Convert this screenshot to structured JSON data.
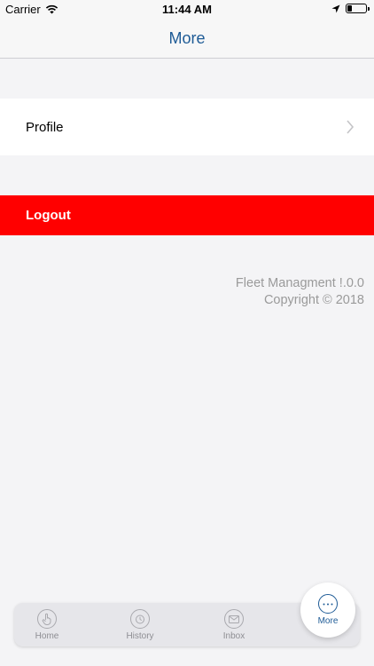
{
  "status_bar": {
    "carrier": "Carrier",
    "time": "11:44 AM",
    "battery_level": 0.25
  },
  "nav": {
    "title": "More"
  },
  "menu": {
    "profile_label": "Profile",
    "logout_label": "Logout"
  },
  "app_info": {
    "version_line": "Fleet Managment !.0.0",
    "copyright_line": "Copyright © 2018"
  },
  "tabs": [
    {
      "label": "Home",
      "icon": "hand-pointer-icon"
    },
    {
      "label": "History",
      "icon": "stopwatch-icon"
    },
    {
      "label": "Inbox",
      "icon": "envelope-icon"
    },
    {
      "label": "More",
      "icon": "more-dots-icon",
      "active": true
    }
  ],
  "colors": {
    "accent": "#1e5b96",
    "logout_bg": "#ff0000",
    "background": "#f4f4f6"
  }
}
